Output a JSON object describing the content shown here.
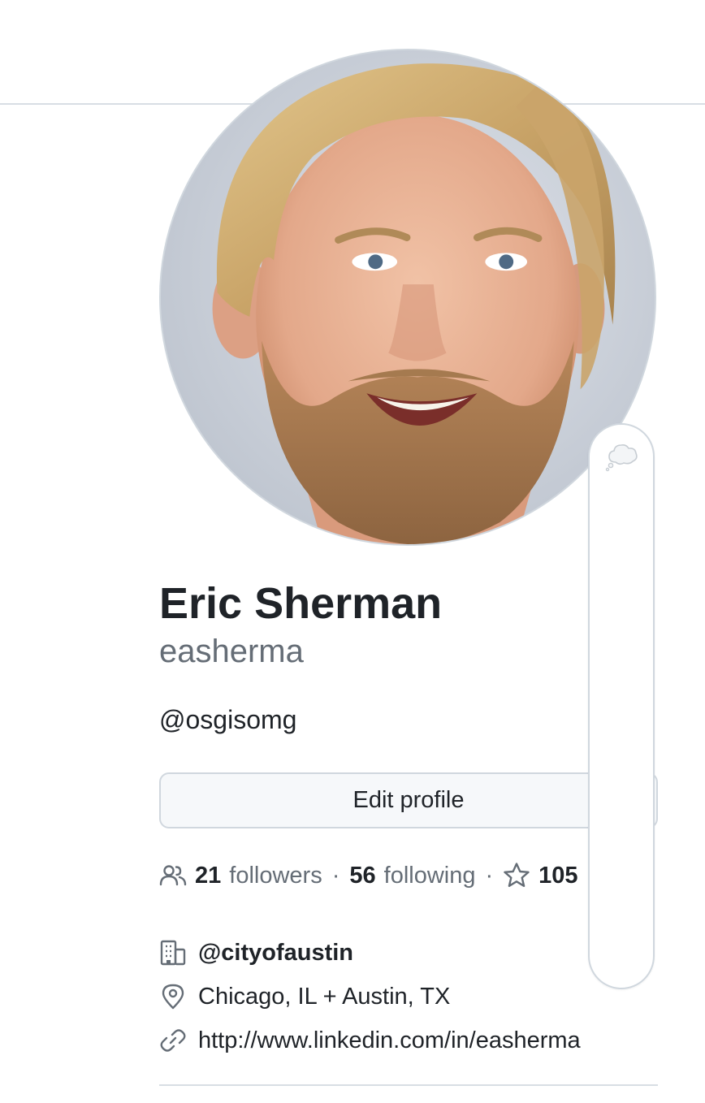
{
  "profile": {
    "full_name": "Eric Sherman",
    "username": "easherma",
    "bio": "@osgisomg",
    "avatar_icon": "user-photo"
  },
  "actions": {
    "edit_profile_label": "Edit profile"
  },
  "status": {
    "icon": "thought-bubble-icon"
  },
  "stats": {
    "followers_count": "21",
    "followers_label": "followers",
    "following_count": "56",
    "following_label": "following",
    "stars_count": "105",
    "separator": "·"
  },
  "details": {
    "organization": "@cityofaustin",
    "location": "Chicago, IL + Austin, TX",
    "website": "http://www.linkedin.com/in/easherma"
  },
  "colors": {
    "text_primary": "#1f2328",
    "text_muted": "#656d76",
    "border": "#d0d7de",
    "button_bg": "#f6f8fa"
  }
}
